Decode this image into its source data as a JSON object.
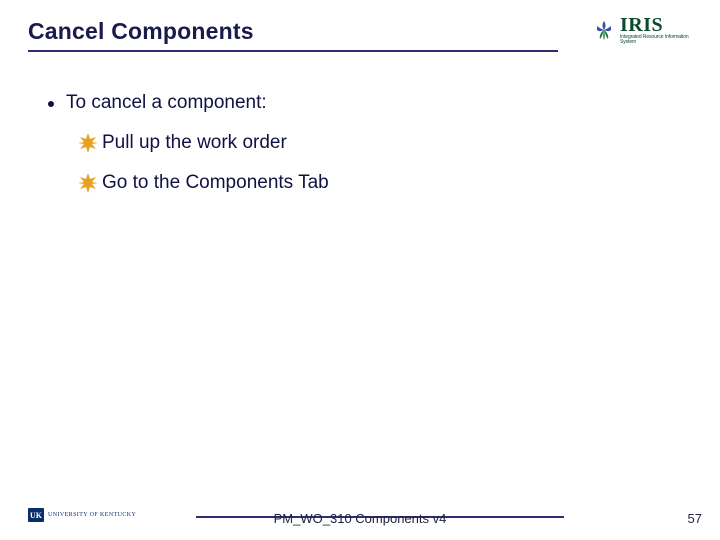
{
  "header": {
    "title": "Cancel Components",
    "logo": {
      "name": "IRIS",
      "tagline": "Integrated Resource Information System"
    }
  },
  "content": {
    "intro": "To cancel a component:",
    "steps": [
      "Pull up the work order",
      "Go to the Components Tab"
    ]
  },
  "footer": {
    "org_badge": "UK",
    "org_name": "UNIVERSITY OF KENTUCKY",
    "doc_ref": "PM_WO_310 Components v4",
    "page": "57"
  }
}
